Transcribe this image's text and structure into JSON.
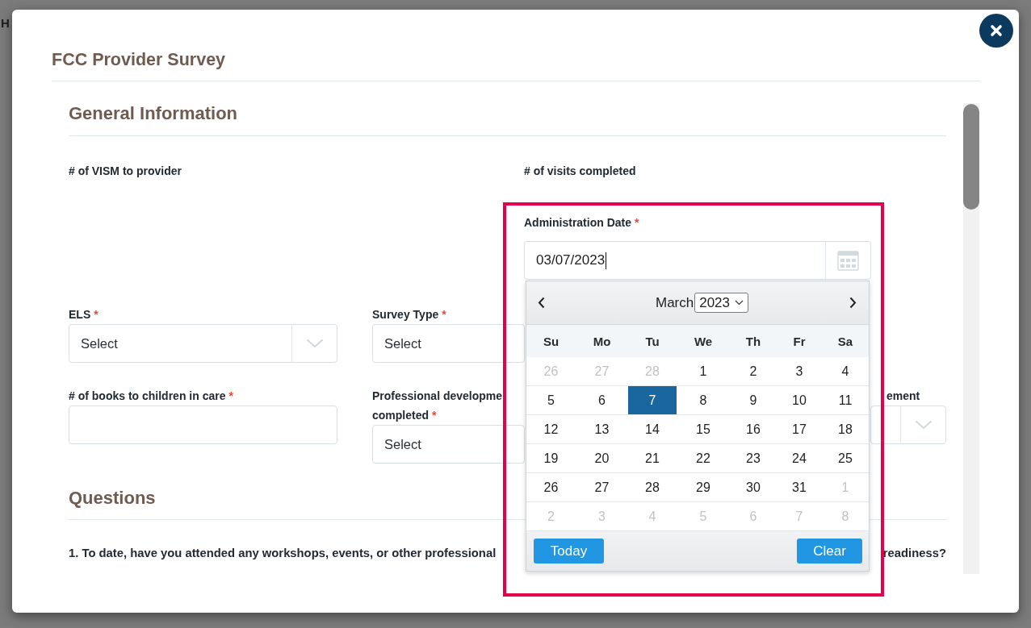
{
  "background_page": {
    "heading_fragment": "H"
  },
  "dialog": {
    "title": "FCC Provider Survey"
  },
  "general_information": {
    "heading": "General Information",
    "counts": [
      {
        "label": "# of VISM to provider"
      },
      {
        "label": "# of visits completed"
      }
    ],
    "administration_date": {
      "label": "Administration Date",
      "required_mark": "*",
      "value": "03/07/2023",
      "focused": true
    },
    "field_rows": [
      [
        {
          "kind": "select",
          "label_lines": [
            "ELS"
          ],
          "required_mark": "*",
          "value": "Select",
          "dropdown_arrow": true
        },
        {
          "kind": "select",
          "label_lines": [
            "Survey Type"
          ],
          "required_mark": "*",
          "value": "Select",
          "dropdown_arrow": false
        }
      ],
      [
        {
          "kind": "input",
          "label_lines": [
            "# of books to children in care"
          ],
          "required_mark": "*"
        },
        {
          "kind": "select",
          "label_lines": [
            "Professional developme",
            "completed"
          ],
          "required_mark": "*",
          "value": "Select",
          "dropdown_arrow": false
        },
        {
          "kind": "select",
          "label_lines": [
            "ement"
          ],
          "dropdown_arrow": true
        }
      ]
    ]
  },
  "calendar": {
    "month": "March",
    "year": "2023",
    "weekdays": [
      "Su",
      "Mo",
      "Tu",
      "We",
      "Th",
      "Fr",
      "Sa"
    ],
    "weeks": [
      [
        {
          "day": "26",
          "other_month": true,
          "selected": false
        },
        {
          "day": "27",
          "other_month": true,
          "selected": false
        },
        {
          "day": "28",
          "other_month": true,
          "selected": false
        },
        {
          "day": "1",
          "other_month": false,
          "selected": false
        },
        {
          "day": "2",
          "other_month": false,
          "selected": false
        },
        {
          "day": "3",
          "other_month": false,
          "selected": false
        },
        {
          "day": "4",
          "other_month": false,
          "selected": false
        }
      ],
      [
        {
          "day": "5",
          "other_month": false,
          "selected": false
        },
        {
          "day": "6",
          "other_month": false,
          "selected": false
        },
        {
          "day": "7",
          "other_month": false,
          "selected": true
        },
        {
          "day": "8",
          "other_month": false,
          "selected": false
        },
        {
          "day": "9",
          "other_month": false,
          "selected": false
        },
        {
          "day": "10",
          "other_month": false,
          "selected": false
        },
        {
          "day": "11",
          "other_month": false,
          "selected": false
        }
      ],
      [
        {
          "day": "12",
          "other_month": false,
          "selected": false
        },
        {
          "day": "13",
          "other_month": false,
          "selected": false
        },
        {
          "day": "14",
          "other_month": false,
          "selected": false
        },
        {
          "day": "15",
          "other_month": false,
          "selected": false
        },
        {
          "day": "16",
          "other_month": false,
          "selected": false
        },
        {
          "day": "17",
          "other_month": false,
          "selected": false
        },
        {
          "day": "18",
          "other_month": false,
          "selected": false
        }
      ],
      [
        {
          "day": "19",
          "other_month": false,
          "selected": false
        },
        {
          "day": "20",
          "other_month": false,
          "selected": false
        },
        {
          "day": "21",
          "other_month": false,
          "selected": false
        },
        {
          "day": "22",
          "other_month": false,
          "selected": false
        },
        {
          "day": "23",
          "other_month": false,
          "selected": false
        },
        {
          "day": "24",
          "other_month": false,
          "selected": false
        },
        {
          "day": "25",
          "other_month": false,
          "selected": false
        }
      ],
      [
        {
          "day": "26",
          "other_month": false,
          "selected": false
        },
        {
          "day": "27",
          "other_month": false,
          "selected": false
        },
        {
          "day": "28",
          "other_month": false,
          "selected": false
        },
        {
          "day": "29",
          "other_month": false,
          "selected": false
        },
        {
          "day": "30",
          "other_month": false,
          "selected": false
        },
        {
          "day": "31",
          "other_month": false,
          "selected": false
        },
        {
          "day": "1",
          "other_month": true,
          "selected": false
        }
      ],
      [
        {
          "day": "2",
          "other_month": true,
          "selected": false
        },
        {
          "day": "3",
          "other_month": true,
          "selected": false
        },
        {
          "day": "4",
          "other_month": true,
          "selected": false
        },
        {
          "day": "5",
          "other_month": true,
          "selected": false
        },
        {
          "day": "6",
          "other_month": true,
          "selected": false
        },
        {
          "day": "7",
          "other_month": true,
          "selected": false
        },
        {
          "day": "8",
          "other_month": true,
          "selected": false
        }
      ]
    ],
    "today_button": "Today",
    "clear_button": "Clear"
  },
  "questions": {
    "heading": "Questions",
    "items": [
      {
        "text_start": "1. To date, have you attended any workshops, events, or other professional",
        "text_end": "readiness?"
      }
    ]
  }
}
